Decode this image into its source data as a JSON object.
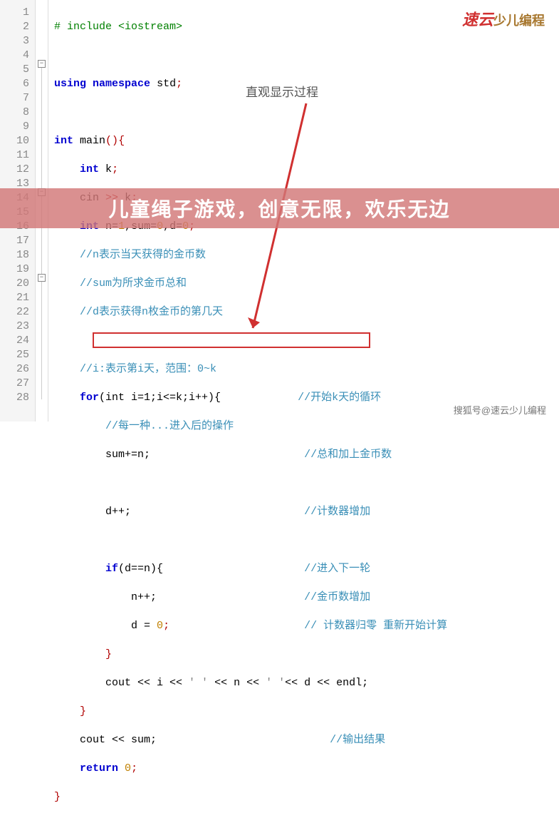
{
  "lines": {
    "l1": "# include <iostream>",
    "l3_kw1": "using",
    "l3_kw2": "namespace",
    "l3_id": "std",
    "l3_semi": ";",
    "l5_kw": "int",
    "l5_fn": "main",
    "l5_paren": "()",
    "l5_brace": "{",
    "l6_kw": "int",
    "l6_id": "k",
    "l6_semi": ";",
    "l7_cin": "cin",
    "l7_op": ">>",
    "l7_id": "k",
    "l7_semi": ";",
    "l8_kw": "int",
    "l8_a": "n=",
    "l8_n1": "1",
    "l8_b": ",sum=",
    "l8_n2": "0",
    "l8_c": ",d=",
    "l8_n3": "0",
    "l8_semi": ";",
    "l9": "//n表示当天获得的金币数",
    "l10": "//sum为所求金币总和",
    "l11": "//d表示获得n枚金币的第几天",
    "l13": "//i:表示第i天，范围：0~k",
    "l14_kw": "for",
    "l14_rest": "(int i=1;i<=k;i++){",
    "l14_cm": "//开始k天的循环",
    "l15": "//每一种...进入后的操作",
    "l16_a": "sum+=n;",
    "l16_cm": "//总和加上金币数",
    "l18_a": "d++;",
    "l18_cm": "//计数器增加",
    "l20_kw": "if",
    "l20_rest": "(d==n){",
    "l20_cm": "//进入下一轮",
    "l21_a": "n++;",
    "l21_cm": "//金币数增加",
    "l22_a": "d = ",
    "l22_n": "0",
    "l22_semi": ";",
    "l22_cm": "// 计数器归零 重新开始计算",
    "l23_brace": "}",
    "l24_a": "cout << i << ",
    "l24_s1": "' '",
    "l24_b": " << n << ",
    "l24_s2": "' '",
    "l24_c": "<< d << endl;",
    "l25_brace": "}",
    "l26_a": "cout << sum;",
    "l26_cm": "//输出结果",
    "l27_kw": "return",
    "l27_n": "0",
    "l27_semi": ";",
    "l28_brace": "}"
  },
  "lineNumbers": [
    "1",
    "2",
    "3",
    "4",
    "5",
    "6",
    "7",
    "8",
    "9",
    "10",
    "11",
    "12",
    "13",
    "14",
    "15",
    "16",
    "17",
    "18",
    "19",
    "20",
    "21",
    "22",
    "23",
    "24",
    "25",
    "26",
    "27",
    "28"
  ],
  "annotation": "直观显示过程",
  "banner": "儿童绳子游戏，创意无限，欢乐无边",
  "watermark": {
    "logo": "速云",
    "text": "少儿编程"
  },
  "footer": "搜狐号@速云少儿编程"
}
